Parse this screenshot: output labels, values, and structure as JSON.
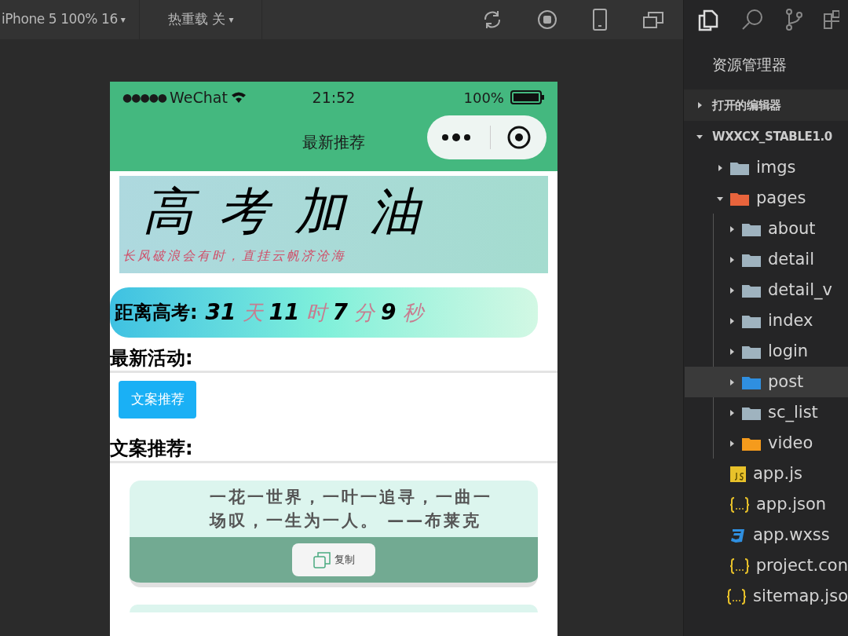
{
  "toolbar": {
    "device": "iPhone 5 100% 16",
    "device_caret": "▾",
    "hot_reload": "热重载 关",
    "hot_reload_caret": "▾"
  },
  "phone": {
    "status": {
      "signal": "●●●●●",
      "carrier": "WeChat",
      "time": "21:52",
      "battery": "100%"
    },
    "nav_title": "最新推荐",
    "banner": {
      "title": "高 考 加 油",
      "subtitle": "长风破浪会有时，直挂云帆济沧海"
    },
    "countdown": {
      "label": "距离高考:",
      "parts": [
        {
          "value": "31",
          "unit": "天"
        },
        {
          "value": "11",
          "unit": "时"
        },
        {
          "value": "7",
          "unit": "分"
        },
        {
          "value": "9",
          "unit": "秒"
        }
      ]
    },
    "activity_heading": "最新活动:",
    "activity_button": "文案推荐",
    "copy_heading": "文案推荐:",
    "cards": [
      {
        "text": "一花一世界，一叶一追寻，一曲一场叹，一生为一人。 ——布莱克",
        "copy_label": "复制"
      }
    ]
  },
  "explorer": {
    "title": "资源管理器",
    "sections": [
      {
        "label": "打开的编辑器",
        "expanded": false
      },
      {
        "label": "WXXCX_STABLE1.0",
        "expanded": true
      }
    ],
    "tree": [
      {
        "label": "imgs",
        "kind": "folder",
        "color": "#9fb3bf",
        "expanded": false,
        "selected": false
      },
      {
        "label": "pages",
        "kind": "folder",
        "color": "#e8643c",
        "expanded": true,
        "selected": false,
        "children": [
          {
            "label": "about",
            "kind": "folder",
            "color": "#9fb3bf",
            "expanded": false,
            "selected": false
          },
          {
            "label": "detail",
            "kind": "folder",
            "color": "#9fb3bf",
            "expanded": false,
            "selected": false
          },
          {
            "label": "detail_v",
            "kind": "folder",
            "color": "#9fb3bf",
            "expanded": false,
            "selected": false
          },
          {
            "label": "index",
            "kind": "folder",
            "color": "#9fb3bf",
            "expanded": false,
            "selected": false
          },
          {
            "label": "login",
            "kind": "folder",
            "color": "#9fb3bf",
            "expanded": false,
            "selected": false
          },
          {
            "label": "post",
            "kind": "folder",
            "color": "#2f8fe0",
            "expanded": false,
            "selected": true
          },
          {
            "label": "sc_list",
            "kind": "folder",
            "color": "#9fb3bf",
            "expanded": false,
            "selected": false
          },
          {
            "label": "video",
            "kind": "folder",
            "color": "#f59b1c",
            "expanded": false,
            "selected": false
          }
        ]
      },
      {
        "label": "app.js",
        "kind": "js",
        "selected": false
      },
      {
        "label": "app.json",
        "kind": "json",
        "selected": false
      },
      {
        "label": "app.wxss",
        "kind": "css",
        "selected": false
      },
      {
        "label": "project.con",
        "kind": "json",
        "selected": false
      },
      {
        "label": "sitemap.jso",
        "kind": "json",
        "selected": false
      }
    ]
  }
}
